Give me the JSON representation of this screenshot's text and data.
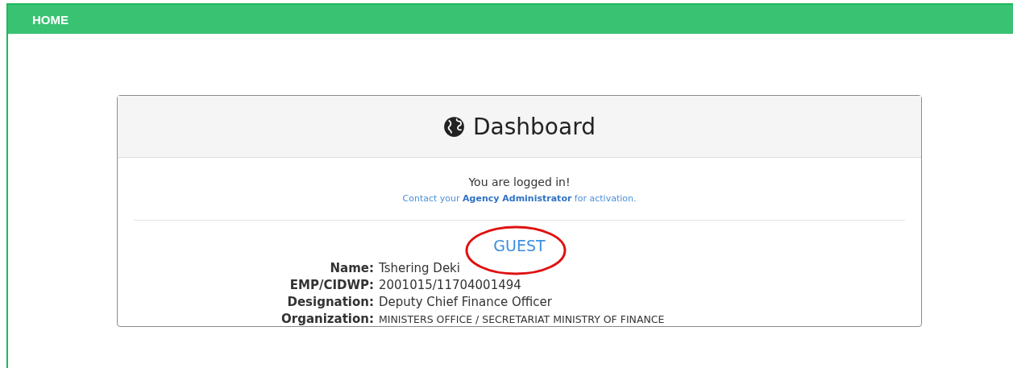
{
  "navbar": {
    "title": "HOME"
  },
  "card": {
    "title": "Dashboard",
    "message": "You are logged in!",
    "note": "Contact your **Agency Administrator** for activation.",
    "role": {
      "text": "GUEST",
      "circled": true
    },
    "fields": [
      {
        "label": "Name:",
        "value": "Tshering Deki",
        "kind": "text"
      },
      {
        "label": "EMP/CIDWP:",
        "value": "2001015/11704001494",
        "kind": "text"
      },
      {
        "label": "Designation:",
        "value": "Deputy Chief Finance Officer",
        "kind": "text"
      },
      {
        "label": "Organization:",
        "value": "MINISTERS OFFICE / SECRETARIAT MINISTRY OF FINANCE",
        "kind": "caps"
      }
    ]
  }
}
